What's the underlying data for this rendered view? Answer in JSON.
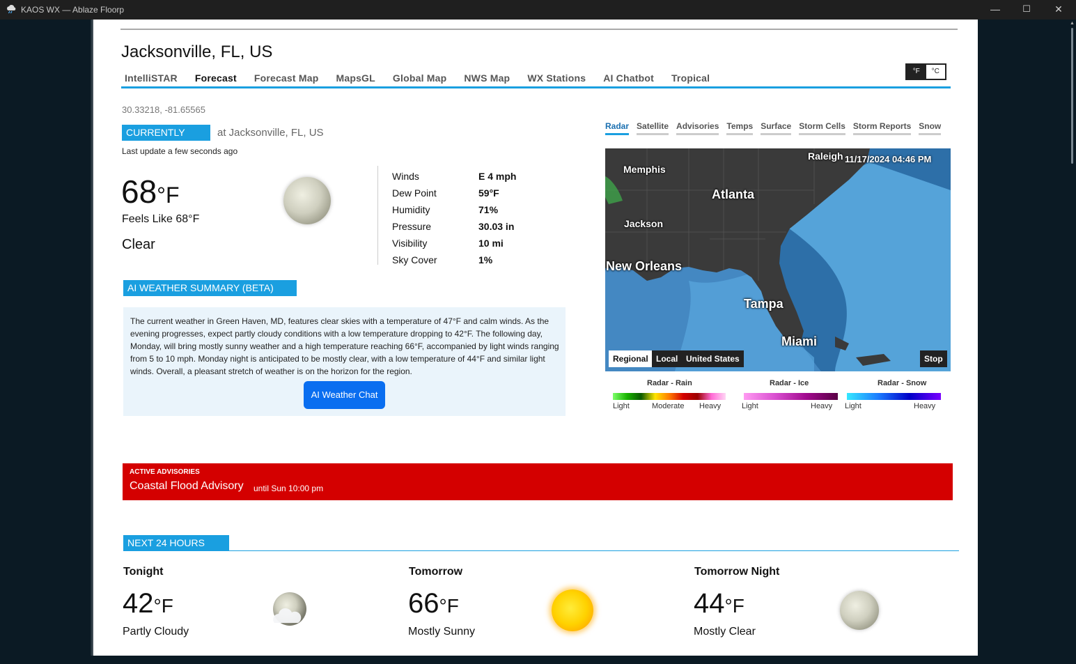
{
  "window": {
    "title": "KAOS WX — Ablaze Floorp",
    "minimize": "—",
    "maximize": "☐",
    "close": "✕"
  },
  "location": {
    "title": "Jacksonville, FL, US",
    "coords": "30.33218, -81.65565"
  },
  "nav": {
    "tabs": [
      "IntelliSTAR",
      "Forecast",
      "Forecast Map",
      "MapsGL",
      "Global Map",
      "NWS Map",
      "WX Stations",
      "AI Chatbot",
      "Tropical"
    ],
    "active": "Forecast"
  },
  "units": {
    "f": "°F",
    "c": "°C",
    "selected": "°F"
  },
  "current": {
    "label": "CURRENTLY",
    "at": "at Jacksonville, FL, US",
    "last_update": "Last update a few seconds ago",
    "temp": "68",
    "unit": "°F",
    "feels_like": "Feels Like 68°F",
    "condition": "Clear",
    "icon": "moon-clear-icon",
    "details": [
      {
        "label": "Winds",
        "value": "E 4 mph"
      },
      {
        "label": "Dew Point",
        "value": "59°F"
      },
      {
        "label": "Humidity",
        "value": "71%"
      },
      {
        "label": "Pressure",
        "value": "30.03 in"
      },
      {
        "label": "Visibility",
        "value": "10 mi"
      },
      {
        "label": "Sky Cover",
        "value": "1%"
      }
    ]
  },
  "ai_summary": {
    "label": "AI WEATHER SUMMARY (BETA)",
    "text": "The current weather in Green Haven, MD, features clear skies with a temperature of 47°F and calm winds. As the evening progresses, expect partly cloudy conditions with a low temperature dropping to 42°F. The following day, Monday, will bring mostly sunny weather and a high temperature reaching 66°F, accompanied by light winds ranging from 5 to 10 mph. Monday night is anticipated to be mostly clear, with a low temperature of 44°F and similar light winds. Overall, a pleasant stretch of weather is on the horizon for the region.",
    "button": "AI Weather Chat"
  },
  "map": {
    "tabs": [
      "Radar",
      "Satellite",
      "Advisories",
      "Temps",
      "Surface",
      "Storm Cells",
      "Storm Reports",
      "Snow"
    ],
    "active_tab": "Radar",
    "timestamp": "11/17/2024 04:46 PM",
    "cities": [
      "Raleigh",
      "Memphis",
      "Atlanta",
      "Jackson",
      "New Orleans",
      "Tampa",
      "Miami"
    ],
    "buttons": [
      "Regional",
      "Local",
      "United States"
    ],
    "selected_button": "Regional",
    "stop": "Stop",
    "colors": {
      "ocean": "#2d6fa8",
      "shelf": "#5aa8de",
      "land": "#3a3a3a"
    }
  },
  "legend": [
    {
      "title": "Radar - Rain",
      "labels": [
        "Light",
        "Moderate",
        "Heavy"
      ]
    },
    {
      "title": "Radar - Ice",
      "labels": [
        "Light",
        "Heavy"
      ]
    },
    {
      "title": "Radar - Snow",
      "labels": [
        "Light",
        "Heavy"
      ]
    }
  ],
  "advisory": {
    "caption": "ACTIVE ADVISORIES",
    "name": "Coastal Flood Advisory",
    "until": "until Sun 10:00 pm",
    "color": "#d40000"
  },
  "next24": {
    "label": "NEXT 24 HOURS",
    "periods": [
      {
        "name": "Tonight",
        "temp": "42",
        "unit": "°F",
        "condition": "Partly Cloudy",
        "icon": "moon-cloud-icon"
      },
      {
        "name": "Tomorrow",
        "temp": "66",
        "unit": "°F",
        "condition": "Mostly Sunny",
        "icon": "sun-icon"
      },
      {
        "name": "Tomorrow Night",
        "temp": "44",
        "unit": "°F",
        "condition": "Mostly Clear",
        "icon": "moon-clear-icon"
      }
    ]
  },
  "accent": "#1a9fe0"
}
